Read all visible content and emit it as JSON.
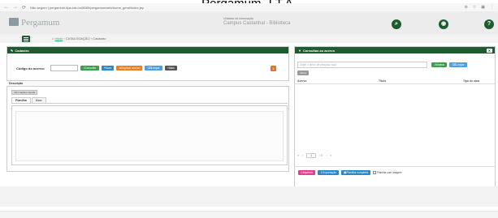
{
  "caption": "Pergamum- I.T.A.",
  "browser": {
    "url": "Não seguro | pergamum.ifpa.edu.br/8080/pergamumweb/home_geral/index.jsp"
  },
  "header": {
    "logo_text": "Pergamum",
    "unit_label": "Unidade de informação",
    "unit_name": "Campus Castanhal - Biblioteca"
  },
  "breadcrumb": {
    "home": "Início",
    "section": "CATALOGAÇÃO",
    "page": "Cadastro"
  },
  "cadastro": {
    "title": "Cadastro",
    "code_label": "Código do acervo:",
    "buttons": {
      "consultar": "Consultar",
      "novo": "Novo",
      "duplicar": "Duplicar acervo",
      "limpar": "Limpar",
      "mais": "Mais"
    },
    "badge": "1",
    "description_tab": "Descrição",
    "info_tag": "Informações Gerais",
    "subtabs": [
      "Planilha",
      "Marc"
    ]
  },
  "consulta": {
    "title": "Consultas ao acervo",
    "search_placeholder": "Digite o termo de pesquisa aqui",
    "buttons": {
      "mostrar": "Mostrar",
      "limpar": "Limpar"
    },
    "filter_tag": "Filtros",
    "columns": [
      "Acervo",
      "Título",
      "Tipo de obra"
    ],
    "pager": {
      "first": "«",
      "prev": "‹",
      "page": "1",
      "total": "/ 0",
      "next": "›",
      "last": "»"
    },
    "actions": {
      "imprimir": "Imprimir",
      "exportacao": "Exportação",
      "planilha": "Planilha completa"
    },
    "checkbox_label": "Planilha com imagem"
  },
  "colors": {
    "brand_green": "#1e5b2f",
    "button_green": "#3aa14a",
    "button_blue": "#2e86c6",
    "button_orange": "#ef7d22",
    "button_pink": "#e23d8e"
  }
}
